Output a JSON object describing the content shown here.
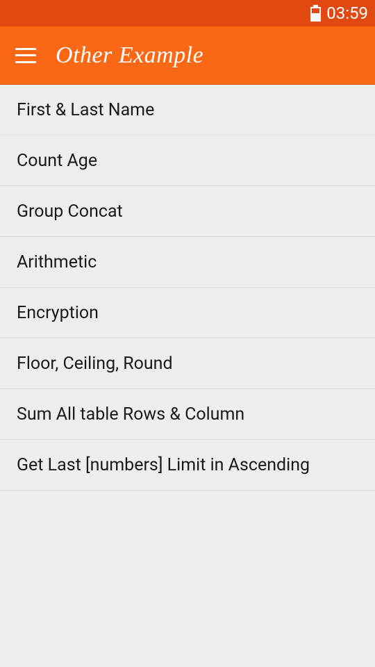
{
  "statusBar": {
    "time": "03:59"
  },
  "appBar": {
    "title": "Other Example"
  },
  "list": {
    "items": [
      {
        "label": "First & Last Name"
      },
      {
        "label": "Count Age"
      },
      {
        "label": "Group Concat"
      },
      {
        "label": "Arithmetic"
      },
      {
        "label": "Encryption"
      },
      {
        "label": "Floor, Ceiling, Round"
      },
      {
        "label": "Sum All table Rows & Column"
      },
      {
        "label": "Get Last [numbers] Limit in Ascending"
      }
    ]
  }
}
